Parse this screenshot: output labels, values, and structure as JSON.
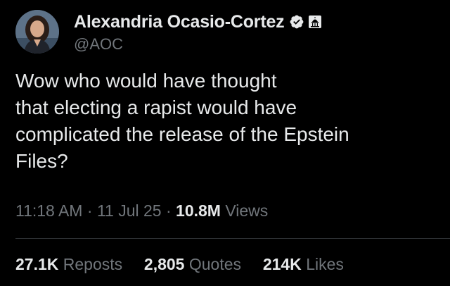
{
  "author": {
    "display_name": "Alexandria Ocasio-Cortez",
    "handle": "@AOC",
    "avatar_icon": "profile-photo",
    "verified_icon": "verified-badge-icon",
    "affiliation_icon": "government-capitol-icon"
  },
  "tweet": {
    "text": "Wow who would have thought\nthat electing a rapist would have\ncomplicated the release of the Epstein\nFiles?"
  },
  "meta": {
    "time": "11:18 AM",
    "separator": "·",
    "date": "11 Jul 25",
    "views_count": "10.8M",
    "views_label": "Views"
  },
  "stats": {
    "reposts_count": "27.1K",
    "reposts_label": "Reposts",
    "quotes_count": "2,805",
    "quotes_label": "Quotes",
    "likes_count": "214K",
    "likes_label": "Likes"
  },
  "colors": {
    "background": "#000000",
    "primary_text": "#e7e9ea",
    "secondary_text": "#71767b",
    "verified_blue": "#1d9bf0",
    "divider": "#2f3336"
  }
}
